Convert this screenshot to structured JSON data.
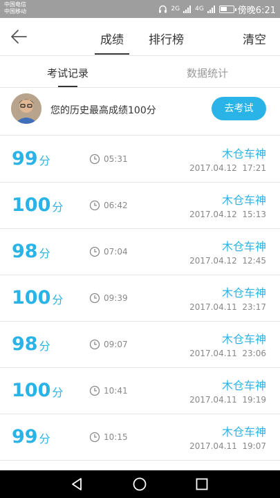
{
  "status_bar": {
    "carrier1": "中国电信",
    "carrier2": "中国移动",
    "sig1": "2G",
    "sig2": "4G",
    "time": "傍晚6:21"
  },
  "header": {
    "tabs": [
      {
        "label": "成绩",
        "active": true
      },
      {
        "label": "排行榜",
        "active": false
      }
    ],
    "clear_label": "清空"
  },
  "subtabs": [
    {
      "label": "考试记录",
      "active": true
    },
    {
      "label": "数据统计",
      "active": false
    }
  ],
  "best": {
    "text": "您的历史最高成绩100分",
    "button_label": "去考试"
  },
  "records": [
    {
      "score": "99",
      "unit": "分",
      "duration": "05:31",
      "name": "木仓车神",
      "date": "2017.04.12  17:21"
    },
    {
      "score": "100",
      "unit": "分",
      "duration": "06:42",
      "name": "木仓车神",
      "date": "2017.04.12  15:13"
    },
    {
      "score": "98",
      "unit": "分",
      "duration": "07:04",
      "name": "木仓车神",
      "date": "2017.04.12  12:45"
    },
    {
      "score": "100",
      "unit": "分",
      "duration": "09:39",
      "name": "木仓车神",
      "date": "2017.04.11  23:17"
    },
    {
      "score": "98",
      "unit": "分",
      "duration": "09:07",
      "name": "木仓车神",
      "date": "2017.04.11  23:06"
    },
    {
      "score": "100",
      "unit": "分",
      "duration": "10:41",
      "name": "木仓车神",
      "date": "2017.04.11  19:19"
    },
    {
      "score": "99",
      "unit": "分",
      "duration": "10:15",
      "name": "木仓车神",
      "date": "2017.04.11  19:07"
    }
  ],
  "colors": {
    "accent": "#2ab3e6",
    "status_bar": "#9e9e9e",
    "nav_bar": "#000000"
  }
}
